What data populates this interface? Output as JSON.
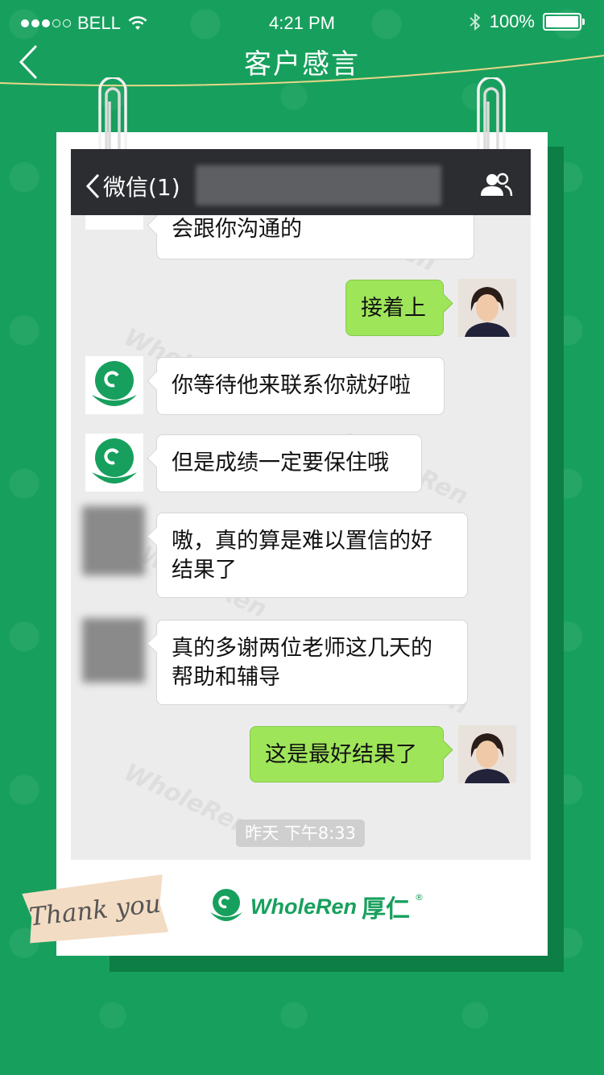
{
  "status_bar": {
    "carrier": "BELL",
    "time": "4:21 PM",
    "battery": "100%",
    "signal_filled": 3,
    "signal_total": 5
  },
  "nav": {
    "title": "客户感言",
    "back_icon": "chevron-left-icon"
  },
  "chat": {
    "back_label": "微信(1)",
    "messages": [
      {
        "side": "left",
        "avatar": "logo",
        "text": "会跟你沟通的"
      },
      {
        "side": "right",
        "avatar": "person",
        "text": "接着上"
      },
      {
        "side": "left",
        "avatar": "logo",
        "text": "你等待他来联系你就好啦"
      },
      {
        "side": "left",
        "avatar": "logo",
        "text": "但是成绩一定要保住哦"
      },
      {
        "side": "left",
        "avatar": "blurred",
        "text": "嗷，真的算是难以置信的好结果了"
      },
      {
        "side": "left",
        "avatar": "blurred",
        "text": "真的多谢两位老师这几天的帮助和辅导"
      },
      {
        "side": "right",
        "avatar": "person",
        "text": "这是最好结果了"
      }
    ],
    "timestamp": "昨天 下午8:33"
  },
  "footer": {
    "thank_you": "Thank you",
    "brand_en": "WholeRen",
    "brand_cn": "厚仁",
    "registered": "®"
  },
  "colors": {
    "background": "#17a05d",
    "bubble_right": "#9fe55a",
    "chat_header": "#2b2d31"
  }
}
